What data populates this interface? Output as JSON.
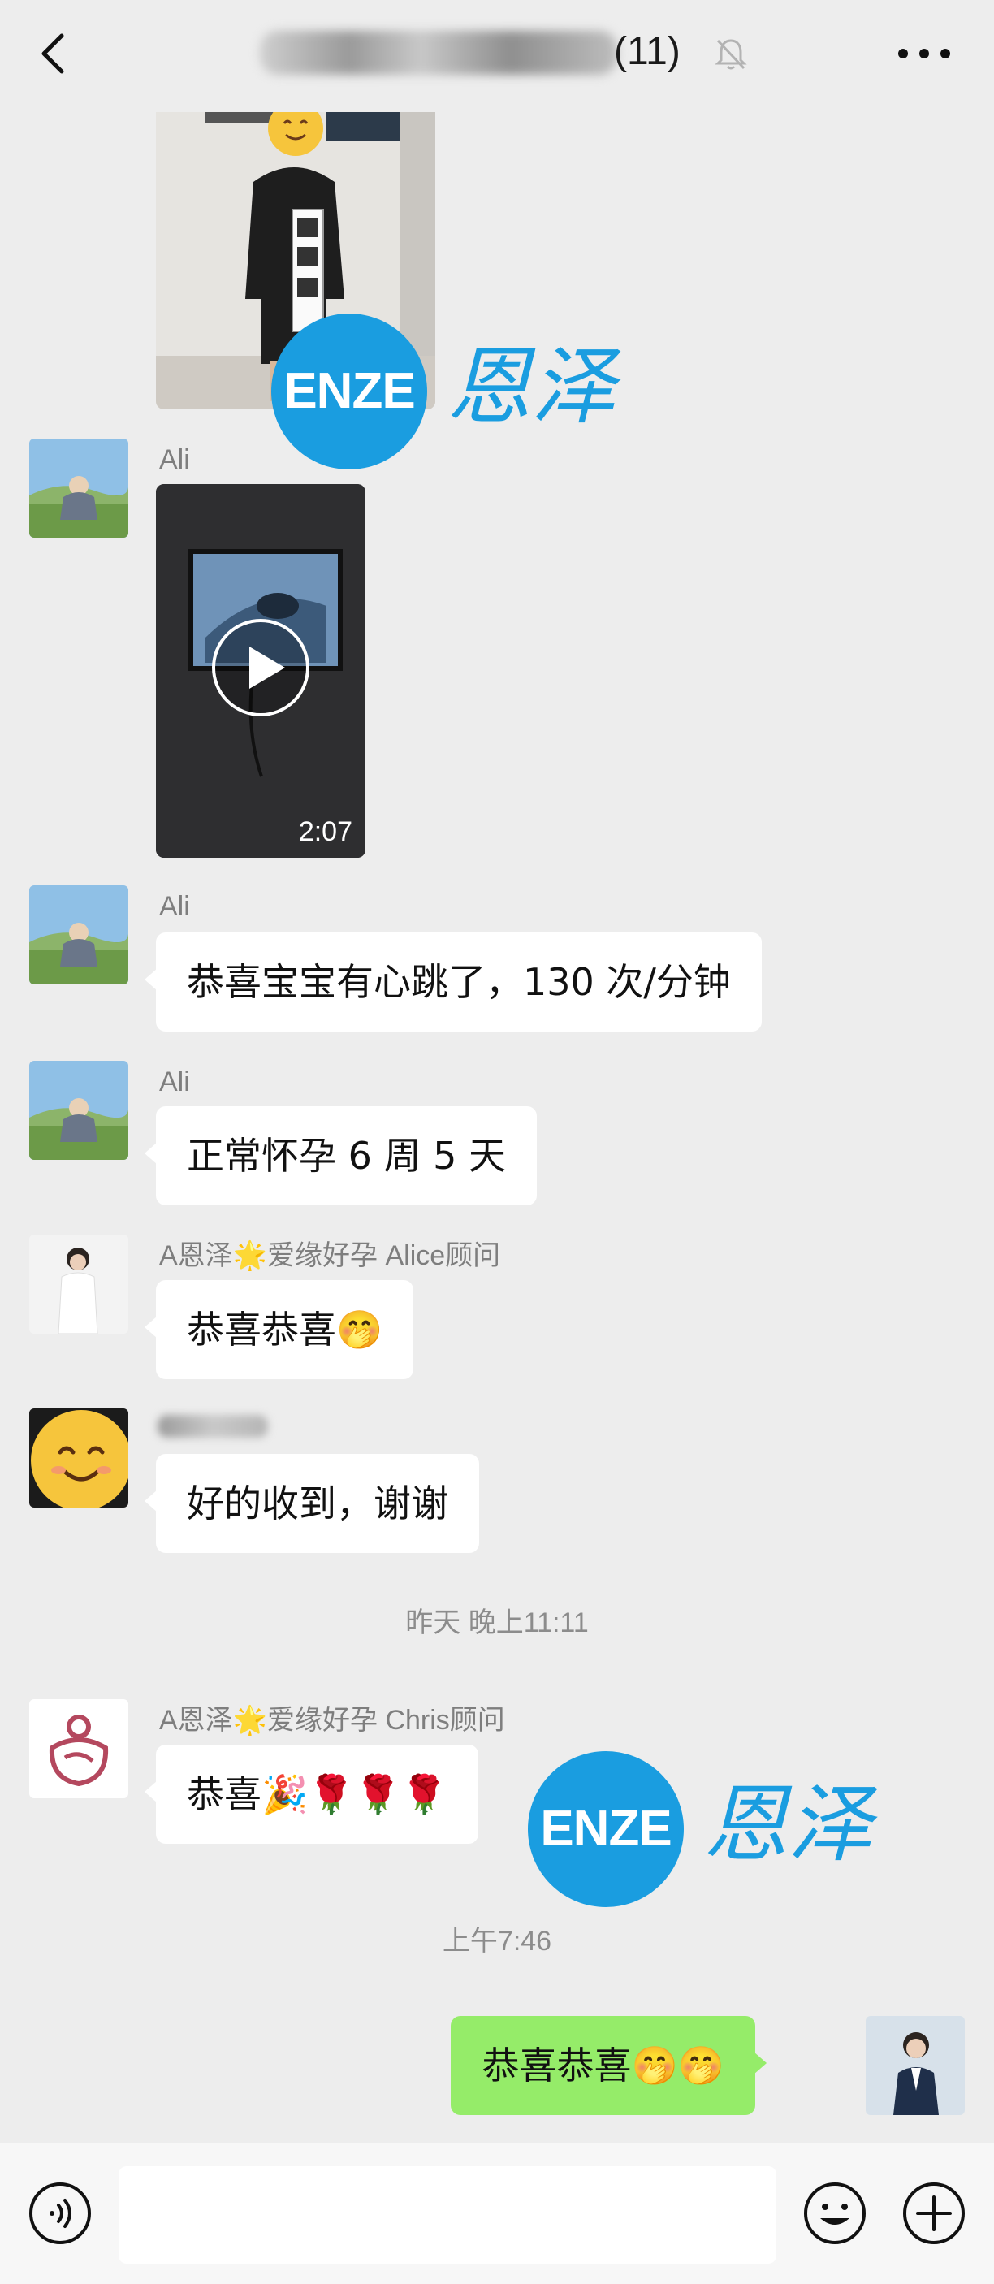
{
  "header": {
    "group_count": "(11)"
  },
  "watermark": {
    "logo_text": "ENZE",
    "brand_text": "恩泽"
  },
  "messages": [
    {
      "sender": "Ali"
    },
    {
      "sender": "Ali",
      "video_duration": "2:07"
    },
    {
      "sender": "Ali",
      "text": "恭喜宝宝有心跳了，130 次/分钟"
    },
    {
      "sender": "Ali",
      "text": "正常怀孕 6 周 5 天"
    },
    {
      "sender": "A恩泽🌟爱缘好孕 Alice顾问",
      "text": "恭喜恭喜🤭"
    },
    {
      "sender": "",
      "text": "好的收到，谢谢"
    },
    {
      "timestamp": "昨天 晚上11:11"
    },
    {
      "sender": "A恩泽🌟爱缘好孕 Chris顾问",
      "text": "恭喜🎉🌹🌹🌹"
    },
    {
      "timestamp": "上午7:46"
    },
    {
      "sender": "me",
      "text": "恭喜恭喜🤭🤭"
    }
  ],
  "colors": {
    "background": "#ededed",
    "bubble_incoming": "#ffffff",
    "bubble_outgoing": "#95ec69",
    "brand_blue": "#1a9de0"
  },
  "icons": {
    "back": "chevron-left-icon",
    "mute": "bell-off-icon",
    "more": "more-dots-icon",
    "voice": "voice-icon",
    "emoji": "emoji-icon",
    "plus": "plus-icon",
    "play": "play-icon"
  }
}
